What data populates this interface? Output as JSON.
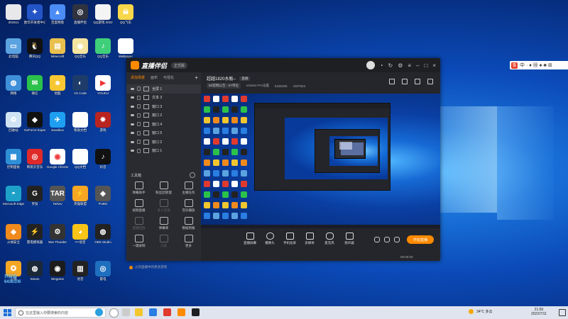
{
  "desktop_icons": [
    {
      "label": "201511",
      "c": "#e8e8ea",
      "t": ""
    },
    {
      "label": "欧华开发者中心",
      "c": "#2455c7",
      "t": "✦"
    },
    {
      "label": "百度网盘",
      "c": "#4c8cf5",
      "t": "▲"
    },
    {
      "label": "直播伴侣",
      "c": "#2f3340",
      "t": "◎"
    },
    {
      "label": "QQ游戏 2022",
      "c": "#f4f4f4",
      "t": ""
    },
    {
      "label": "QQ飞车",
      "c": "#f8d74a",
      "t": "☠"
    },
    {
      "label": "此电脑",
      "c": "#5ba3e0",
      "t": "▭"
    },
    {
      "label": "腾讯QQ",
      "c": "#111",
      "t": "🐧"
    },
    {
      "label": "Minecraft",
      "c": "#e9c04d",
      "t": "▤"
    },
    {
      "label": "QQ音乐",
      "c": "#f5e3a0",
      "t": "◉"
    },
    {
      "label": "QQ音乐",
      "c": "#3fcf7a",
      "t": "♪"
    },
    {
      "label": "Wallpaper",
      "c": "#fff",
      "t": ""
    },
    {
      "label": "网络",
      "c": "#3f8fd9",
      "t": "◍"
    },
    {
      "label": "微信",
      "c": "#2bc24b",
      "t": "✉"
    },
    {
      "label": "优酷",
      "c": "#f7c733",
      "t": "☻"
    },
    {
      "label": "VS Code",
      "c": "#1e3c6a",
      "t": "◐"
    },
    {
      "label": "YOUKU",
      "c": "#fff",
      "t": "▶"
    },
    {
      "label": "回收站",
      "c": "#cfe3f5",
      "t": "♻"
    },
    {
      "label": "GeForce Experience",
      "c": "#111",
      "t": "◆"
    },
    {
      "label": "Sandbox",
      "c": "#1e9ff2",
      "t": "✈"
    },
    {
      "label": "帮助文档",
      "c": "#fff",
      "t": ""
    },
    {
      "label": "游戏",
      "c": "#b8241f",
      "t": "✸"
    },
    {
      "label": "控制面板",
      "c": "#2e8fd6",
      "t": "▦"
    },
    {
      "label": "网易云音乐",
      "c": "#e02a2a",
      "t": "◎"
    },
    {
      "label": "Google Chrome",
      "c": "#fff",
      "t": "◉"
    },
    {
      "label": "QQ文档",
      "c": "#fff",
      "t": ""
    },
    {
      "label": "抖音",
      "c": "#111",
      "t": "♪"
    },
    {
      "label": "Microsoft Edge",
      "c": "#1da1c9",
      "t": "◓"
    },
    {
      "label": "罗技",
      "c": "#222",
      "t": "G"
    },
    {
      "label": "Tarkov",
      "c": "#555",
      "t": "TAR"
    },
    {
      "label": "英雄联盟",
      "c": "#f5a623",
      "t": "⚡"
    },
    {
      "label": "PUBG",
      "c": "#555",
      "t": "◈"
    },
    {
      "label": "火绒安全",
      "c": "#f08a1c",
      "t": "◆"
    },
    {
      "label": "雷电模拟器",
      "c": "#222",
      "t": "⚡"
    },
    {
      "label": "War Thunder",
      "c": "#333",
      "t": "⚙"
    },
    {
      "label": "YY语音",
      "c": "#f8c417",
      "t": "◕"
    },
    {
      "label": "OBS Studio",
      "c": "#222",
      "t": "◍"
    },
    {
      "label": "火绒",
      "c": "#f5a623",
      "t": "✪"
    },
    {
      "label": "Steam",
      "c": "#1b2838",
      "t": "◍"
    },
    {
      "label": "Wegame",
      "c": "#1c1c1c",
      "t": "◉"
    },
    {
      "label": "语音",
      "c": "#222",
      "t": "▥"
    },
    {
      "label": "雷电",
      "c": "#1f6fbf",
      "t": "◎"
    }
  ],
  "watermark": {
    "line1": "开启自",
    "line2": "6436106"
  },
  "ime": {
    "s": "S",
    "items": "中 · ♦ ▦ ♠ ♣ ⊞"
  },
  "app": {
    "logo": "直播伴侣",
    "version": "正式版",
    "tabs": [
      "添加场景",
      "画布",
      "可视化"
    ],
    "scenes": [
      "全屏 1",
      "文本 3",
      "窗口 3",
      "窗口 2",
      "窗口 4",
      "窗口 5",
      "窗口 2",
      "窗口 1"
    ],
    "tools_title": "工具箱",
    "tools": [
      {
        "label": "弹幕助手",
        "dim": false
      },
      {
        "label": "粉丝团管理",
        "dim": false
      },
      {
        "label": "主播任务",
        "dim": false
      },
      {
        "label": "视频直播",
        "dim": false
      },
      {
        "label": "多人连线",
        "dim": true
      },
      {
        "label": "音乐播放",
        "dim": false
      },
      {
        "label": "直播回放",
        "dim": true
      },
      {
        "label": "弹幕库",
        "dim": false
      },
      {
        "label": "数据周报",
        "dim": false
      },
      {
        "label": "一键录制",
        "dim": false
      },
      {
        "label": "工具",
        "dim": true
      },
      {
        "label": "更多",
        "dim": false
      }
    ],
    "hint": "火热直播中的更多游戏",
    "room_title": "超越1820水瓶--",
    "room_tag": "直播",
    "info": [
      "bili官网公告 - S7单位",
      "eGame Pro设置",
      "6436106",
      "1937624"
    ],
    "controls": [
      "直播屏幕",
      "摄像头",
      "手机投屏",
      "多媒体",
      "麦克风",
      "扬声器"
    ],
    "go_live": "开始直播",
    "timer": "00:00:00"
  },
  "taskbar": {
    "search_placeholder": "在这里输入你要搜索的内容",
    "weather": "34°C 多云",
    "time": "21:59",
    "date": "2022/7/11"
  }
}
